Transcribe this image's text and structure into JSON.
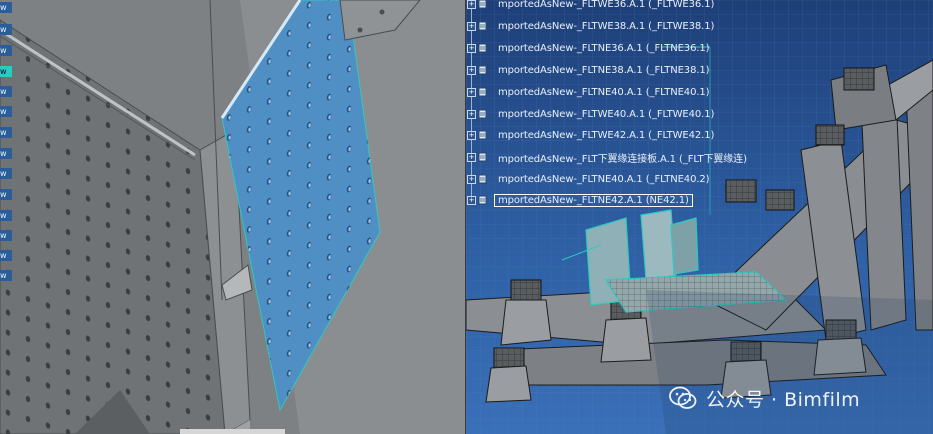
{
  "left_tree_stubs": [
    "w",
    "w",
    "w",
    "w",
    "w",
    "w",
    "w",
    "w",
    "w",
    "w",
    "w",
    "w",
    "w",
    "w"
  ],
  "left_tree_active_index": 3,
  "spec_tree": {
    "items": [
      {
        "label": "mportedAsNew-_FLTWE36.A.1 (_FLTWE36.1)",
        "selected": false
      },
      {
        "label": "mportedAsNew-_FLTWE38.A.1 (_FLTWE38.1)",
        "selected": false
      },
      {
        "label": "mportedAsNew-_FLTNE36.A.1 (_FLTNE36.1)",
        "selected": false
      },
      {
        "label": "mportedAsNew-_FLTNE38.A.1 (_FLTNE38.1)",
        "selected": false
      },
      {
        "label": "mportedAsNew-_FLTNE40.A.1 (_FLTNE40.1)",
        "selected": false
      },
      {
        "label": "mportedAsNew-_FLTWE40.A.1 (_FLTWE40.1)",
        "selected": false
      },
      {
        "label": "mportedAsNew-_FLTWE42.A.1 (_FLTWE42.1)",
        "selected": false
      },
      {
        "label": "mportedAsNew-_FLT下翼缘连接板.A.1 (_FLT下翼缘连)",
        "selected": false
      },
      {
        "label": "mportedAsNew-_FLTNE40.A.1 (_FLTNE40.2)",
        "selected": false
      },
      {
        "label": "mportedAsNew-_FLTNE42.A.1 (NE42.1)",
        "selected": true
      }
    ]
  },
  "watermark": {
    "text": "公众号 · Bimfilm",
    "icon": "wechat-icon"
  },
  "colors": {
    "accent_cyan": "#2fc9c0",
    "selected_plate": "#4f8fc4",
    "viewport_bg": "#2e5fa3"
  }
}
